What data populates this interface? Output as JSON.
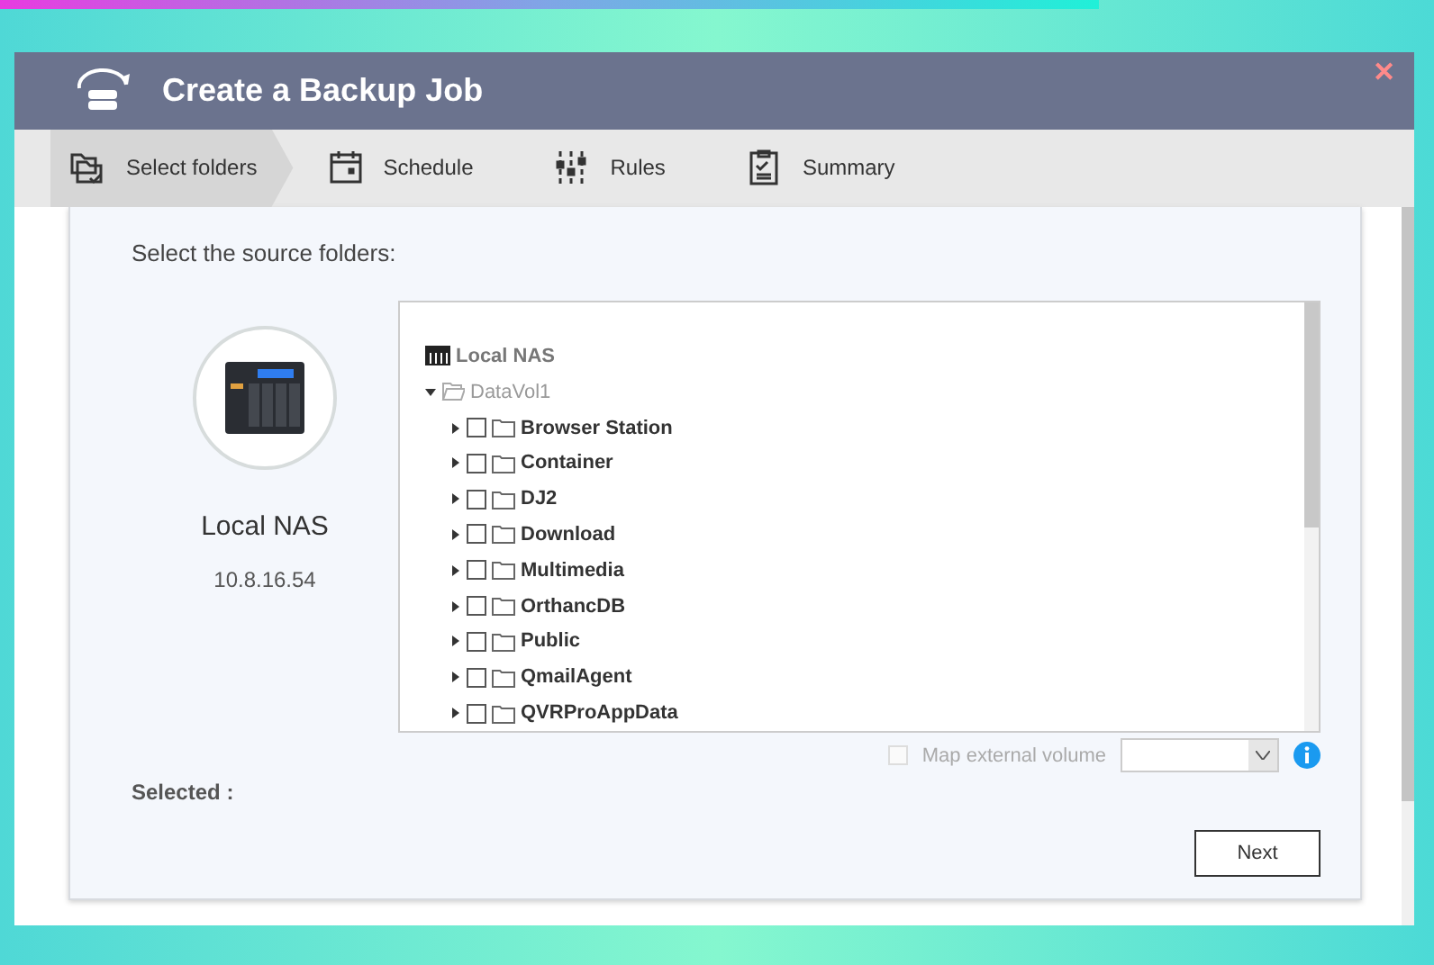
{
  "window": {
    "title": "Create a Backup Job",
    "close": "✕"
  },
  "steps": [
    {
      "label": "Select folders",
      "kind": "folders",
      "selected": true
    },
    {
      "label": "Schedule",
      "kind": "calendar",
      "selected": false
    },
    {
      "label": "Rules",
      "kind": "sliders",
      "selected": false
    },
    {
      "label": "Summary",
      "kind": "clipboard",
      "selected": false
    }
  ],
  "heading": "Select the source folders:",
  "device": {
    "name": "Local NAS",
    "address": "10.8.16.54"
  },
  "tree": {
    "label": "Local NAS",
    "children": [
      {
        "label": "DataVol1",
        "expanded": true,
        "children": [
          {
            "label": "Browser Station",
            "checked": false
          },
          {
            "label": "Container",
            "checked": false
          },
          {
            "label": "DJ2",
            "checked": false
          },
          {
            "label": "Download",
            "checked": false
          },
          {
            "label": "Multimedia",
            "checked": false
          },
          {
            "label": "OrthancDB",
            "checked": false
          },
          {
            "label": "Public",
            "checked": false
          },
          {
            "label": "QmailAgent",
            "checked": false
          },
          {
            "label": "QVRProAppData",
            "checked": false
          }
        ]
      }
    ]
  },
  "map_external": {
    "label": "Map external volume",
    "checked": false,
    "disabled": true
  },
  "selected_label": "Selected :",
  "buttons": [
    "Next"
  ]
}
